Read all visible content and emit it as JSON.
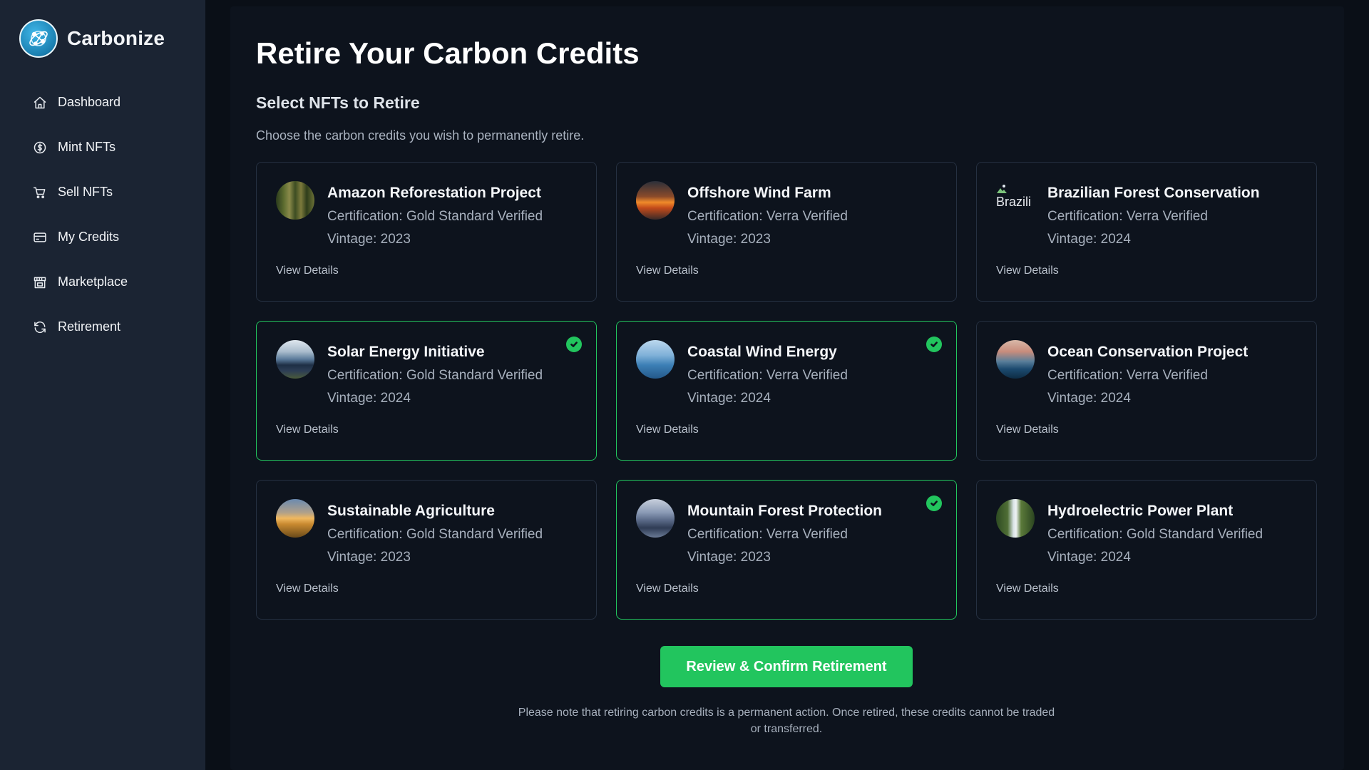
{
  "brand": {
    "name": "Carbonize"
  },
  "nav": [
    {
      "label": "Dashboard",
      "icon": "home-icon"
    },
    {
      "label": "Mint NFTs",
      "icon": "dollar-circle-icon"
    },
    {
      "label": "Sell NFTs",
      "icon": "cart-icon"
    },
    {
      "label": "My Credits",
      "icon": "credit-card-icon"
    },
    {
      "label": "Marketplace",
      "icon": "store-icon"
    },
    {
      "label": "Retirement",
      "icon": "refresh-icon"
    }
  ],
  "page": {
    "title": "Retire Your Carbon Credits",
    "section_title": "Select NFTs to Retire",
    "section_sub": "Choose the carbon credits you wish to permanently retire."
  },
  "cards": [
    {
      "name": "Amazon Reforestation Project",
      "cert": "Certification: Gold Standard Verified",
      "vintage": "Vintage: 2023",
      "details": "View Details",
      "selected": false,
      "image": "forest"
    },
    {
      "name": "Offshore Wind Farm",
      "cert": "Certification: Verra Verified",
      "vintage": "Vintage: 2023",
      "details": "View Details",
      "selected": false,
      "image": "sunset"
    },
    {
      "name": "Brazilian Forest Conservation",
      "cert": "Certification: Verra Verified",
      "vintage": "Vintage: 2024",
      "details": "View Details",
      "selected": false,
      "image": "broken",
      "image_alt": "Brazili"
    },
    {
      "name": "Solar Energy Initiative",
      "cert": "Certification: Gold Standard Verified",
      "vintage": "Vintage: 2024",
      "details": "View Details",
      "selected": true,
      "image": "solar"
    },
    {
      "name": "Coastal Wind Energy",
      "cert": "Certification: Verra Verified",
      "vintage": "Vintage: 2024",
      "details": "View Details",
      "selected": true,
      "image": "windturbine"
    },
    {
      "name": "Ocean Conservation Project",
      "cert": "Certification: Verra Verified",
      "vintage": "Vintage: 2024",
      "details": "View Details",
      "selected": false,
      "image": "ocean"
    },
    {
      "name": "Sustainable Agriculture",
      "cert": "Certification: Gold Standard Verified",
      "vintage": "Vintage: 2023",
      "details": "View Details",
      "selected": false,
      "image": "field"
    },
    {
      "name": "Mountain Forest Protection",
      "cert": "Certification: Verra Verified",
      "vintage": "Vintage: 2023",
      "details": "View Details",
      "selected": true,
      "image": "mountain"
    },
    {
      "name": "Hydroelectric Power Plant",
      "cert": "Certification: Gold Standard Verified",
      "vintage": "Vintage: 2024",
      "details": "View Details",
      "selected": false,
      "image": "waterfall"
    }
  ],
  "cta": {
    "label": "Review & Confirm Retirement"
  },
  "note": "Please note that retiring carbon credits is a permanent action. Once retired, these credits cannot be traded or transferred.",
  "colors": {
    "accent": "#22c55e",
    "sidebar": "#1b2433",
    "background": "#0a0f17"
  }
}
